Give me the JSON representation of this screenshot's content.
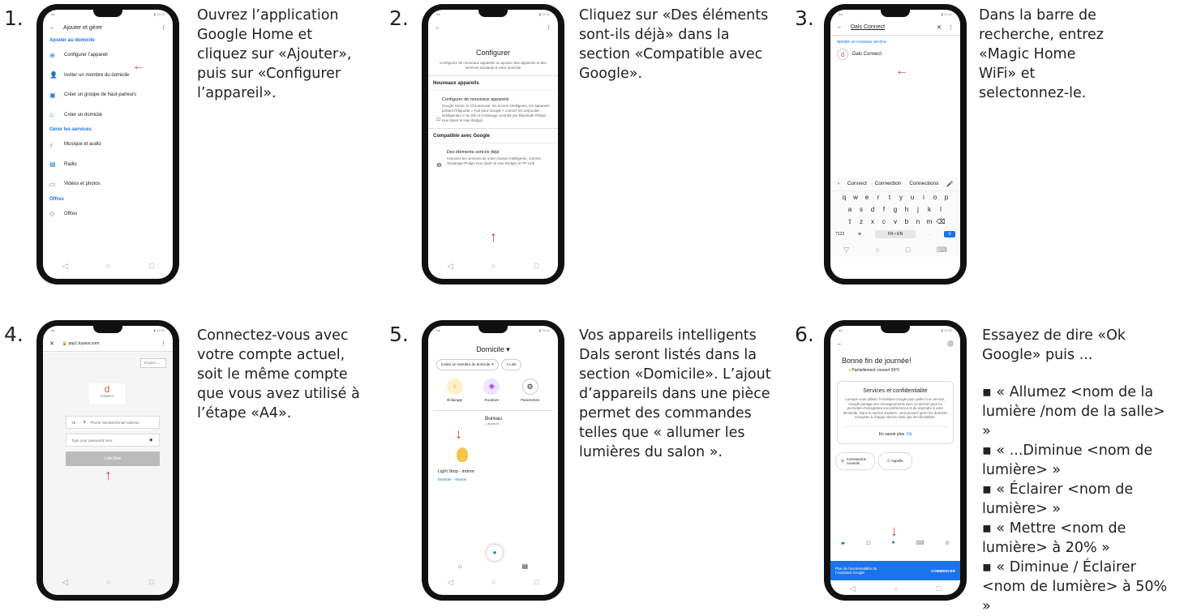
{
  "steps": [
    {
      "number": "1.",
      "text": "Ouvrez l’application Google Home et cliquez sur «Ajouter», puis sur «Configurer l’appareil»."
    },
    {
      "number": "2.",
      "text": "Cliquez sur «Des éléments sont-ils déjà» dans la section «Compatible avec Google»."
    },
    {
      "number": "3.",
      "text": "Dans la barre de recherche, entrez «Magic Home WiFi» et selectonnez-le."
    },
    {
      "number": "4.",
      "text": "Connectez-vous avec votre compte actuel, soit le même compte que vous avez utilisé à l’étape «A4»."
    },
    {
      "number": "5.",
      "text": "Vos appareils intelligents Dals seront listés dans la section «Domicile». L’ajout d’appareils dans une pièce permet des commandes telles que « allumer les lumières du salon »."
    },
    {
      "number": "6.",
      "text": "Essayez de dire «Ok Google» puis ...",
      "bullets": [
        "▪ « Allumez <nom de la lumière /nom de la salle> »",
        "▪ « ...Diminue <nom de lumière> »",
        "▪ « Éclairer <nom de lumière> »",
        "▪ « Mettre <nom de lumière> à 20% »",
        "▪ « Diminue / Éclairer <nom de lumière> à 50% »"
      ]
    }
  ],
  "screen1": {
    "title": "Ajouter et gérer",
    "section1": "Ajouter au domicile",
    "items1": [
      "Configurer l’appareil",
      "Inviter un membre du domicile",
      "Créer un groupe de haut-parleurs",
      "Créer un domicile"
    ],
    "section2": "Gérer les services",
    "items2": [
      "Musique et audio",
      "Radio",
      "Vidéos et photos"
    ],
    "section3": "Offres",
    "items3": [
      "Offres"
    ]
  },
  "screen2": {
    "title": "Configurer",
    "subtitle": "Configurez de nouveaux appareils ou ajoutez des appareils et des services existants à votre domicile",
    "section1": "Nouveaux appareils",
    "item1_title": "Configurer de nouveaux appareils",
    "item1_desc": "Google Home, le Chromecast, les écrans intelligents, les appareils portant l’étiquette « Fait pour Google » comme les ampoules intelligentes C by GE et l’éclairage contrôlé par Bluetooth Philips Hue (sans le Hue Bridge)",
    "section2": "Compatible avec Google",
    "item2_title": "Des éléments sont-ils déjà",
    "item2_desc": "Associez les services de votre maison intelligente, comme l’éclairage Philips Hue (avec le Hue Bridge) et TP-Link"
  },
  "screen3": {
    "search": "Dals Connect",
    "section": "Ajouter un nouveau service",
    "result": "Dals Connect",
    "suggestions": [
      "Connect",
      "Connection",
      "Connections"
    ],
    "row1": [
      "q",
      "w",
      "e",
      "r",
      "t",
      "y",
      "u",
      "i",
      "o",
      "p"
    ],
    "row2": [
      "a",
      "s",
      "d",
      "f",
      "g",
      "h",
      "j",
      "k",
      "l"
    ],
    "row3": [
      "z",
      "x",
      "c",
      "v",
      "b",
      "n",
      "m"
    ],
    "num_key": "?123",
    "lang_key": "FR • EN"
  },
  "screen4": {
    "url": "pay1.tuyaus.com",
    "language": "English",
    "logo_text": "CONNECT",
    "country_code": "+1",
    "phone_placeholder": "Phone Number/Email Address",
    "password_placeholder": "Type your password here",
    "button": "Link Now"
  },
  "screen5": {
    "title": "Domicile",
    "invite": "Inviter un membre du domicile",
    "link": "Link",
    "actions": [
      "Éclairage",
      "Routines",
      "Paramètres"
    ],
    "room": "Bureau",
    "room_count": "1 appareil",
    "device": "Light Strip - Indoor",
    "device_off": "Éteindre",
    "device_on": "Allumer"
  },
  "screen6": {
    "greeting": "Bonne fin de journée!",
    "weather": "Partiellement couvert 59°F",
    "card_title": "Services et confidentialité",
    "card_text": "Lorsque vous utilisez l’Assistant Google pour parler à un service, Google partage des renseignements avec ce dernier pour lui permettre d’enregistrer vos préférences et de répondre à votre demande. Dans la section Explorer, vous pouvez gérer les données envoyées à chaque service ainsi que les réinitialiser.",
    "learn_more": "En savoir plus",
    "ok": "Ok",
    "chip1": "Coronavirus conseils",
    "chip2": "Appelle",
    "banner_text": "Plus de fonctionnalités de l’Assistant Google",
    "banner_button": "COMMENCER"
  }
}
